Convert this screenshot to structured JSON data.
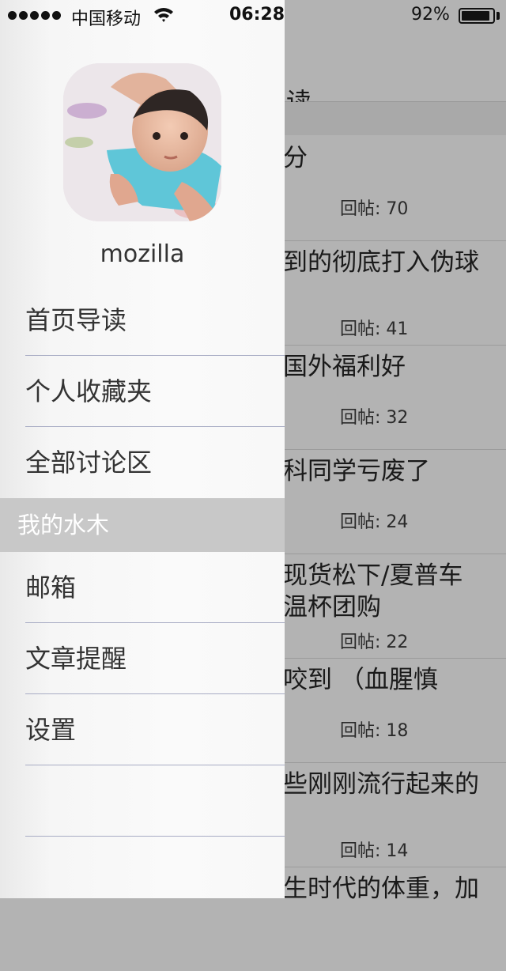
{
  "status_bar": {
    "carrier": "中国移动",
    "time": "06:28",
    "battery_percent": "92%",
    "battery_level": 0.92
  },
  "background": {
    "title": "读",
    "articles": [
      {
        "title": "分",
        "replies": "回帖: 70"
      },
      {
        "title": "到的彻底打入伪球",
        "replies": "回帖: 41"
      },
      {
        "title": "国外福利好",
        "replies": "回帖: 32"
      },
      {
        "title": "科同学亏废了",
        "replies": "回帖: 24"
      },
      {
        "title": "现货松下/夏普车\n温杯团购",
        "replies": "回帖: 22"
      },
      {
        "title": "咬到 （血腥慎",
        "replies": "回帖: 18"
      },
      {
        "title": "些刚刚流行起来的",
        "replies": "回帖: 14"
      },
      {
        "title": "生时代的体重，加",
        "replies": ""
      }
    ]
  },
  "drawer": {
    "username": "mozilla",
    "menu": [
      {
        "label": "首页导读"
      },
      {
        "label": "个人收藏夹"
      },
      {
        "label": "全部讨论区"
      }
    ],
    "section_label": "我的水木",
    "section_menu": [
      {
        "label": "邮箱"
      },
      {
        "label": "文章提醒"
      },
      {
        "label": "设置"
      },
      {
        "label": ""
      }
    ]
  }
}
